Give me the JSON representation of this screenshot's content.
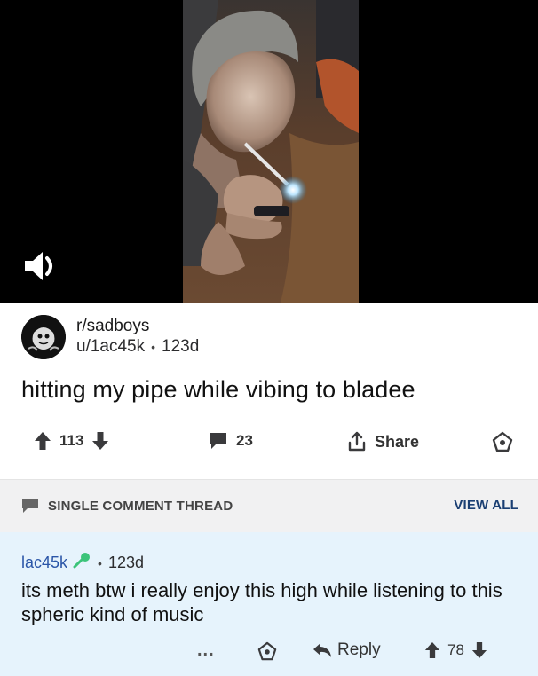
{
  "post": {
    "subreddit": "r/sadboys",
    "author": "u/1ac45k",
    "age": "123d",
    "title": "hitting my pipe while vibing to bladee",
    "upvotes": "113",
    "comments": "23",
    "share_label": "Share"
  },
  "thread": {
    "label": "SINGLE COMMENT THREAD",
    "view_all": "VIEW ALL"
  },
  "comment": {
    "author": "lac45k",
    "age": "123d",
    "body": "its meth btw i really enjoy this high while listening to this spheric kind of music",
    "more": "...",
    "reply_label": "Reply",
    "score": "78"
  },
  "icons": {
    "mute": "speaker-icon",
    "upvote": "arrow-up-icon",
    "downvote": "arrow-down-icon",
    "comments": "speech-bubble-icon",
    "share": "share-icon",
    "award": "award-icon",
    "flair": "microphone-icon",
    "reply": "reply-arrow-icon"
  },
  "colors": {
    "comment_bg": "#e6f3fc",
    "thread_bar_bg": "#f1f1f2",
    "author_link": "#2b56a8",
    "view_all": "#1b3f73",
    "flair": "#3cc47a"
  }
}
